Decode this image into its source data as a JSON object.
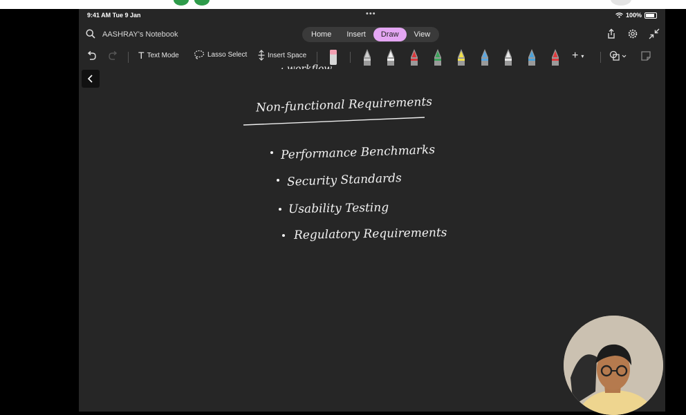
{
  "status": {
    "time": "9:41 AM  Tue 9 Jan",
    "dots": "•••",
    "battery": "100%"
  },
  "header": {
    "notebook": "AASHRAY's Notebook",
    "tabs": [
      {
        "label": "Home",
        "active": false
      },
      {
        "label": "Insert",
        "active": false
      },
      {
        "label": "Draw",
        "active": true
      },
      {
        "label": "View",
        "active": false
      }
    ]
  },
  "toolbar": {
    "text_mode": "Text Mode",
    "lasso_select": "Lasso Select",
    "insert_space": "Insert Space",
    "add": "+",
    "pens": [
      "#cfcfcf",
      "#f0f0f0",
      "#d9373b",
      "#3aa35a",
      "#f2e14a",
      "#5aa6e0",
      "#e8e8e8",
      "#4aa1d9",
      "#e0393d"
    ]
  },
  "notes": {
    "partial_top": "· workflow",
    "title": "Non-functional Requirements",
    "items": [
      "Performance Benchmarks",
      "Security Standards",
      "Usability Testing",
      "Regulatory Requirements"
    ]
  },
  "colors": {
    "accent": "#e4a6f3",
    "canvas": "#262626"
  }
}
